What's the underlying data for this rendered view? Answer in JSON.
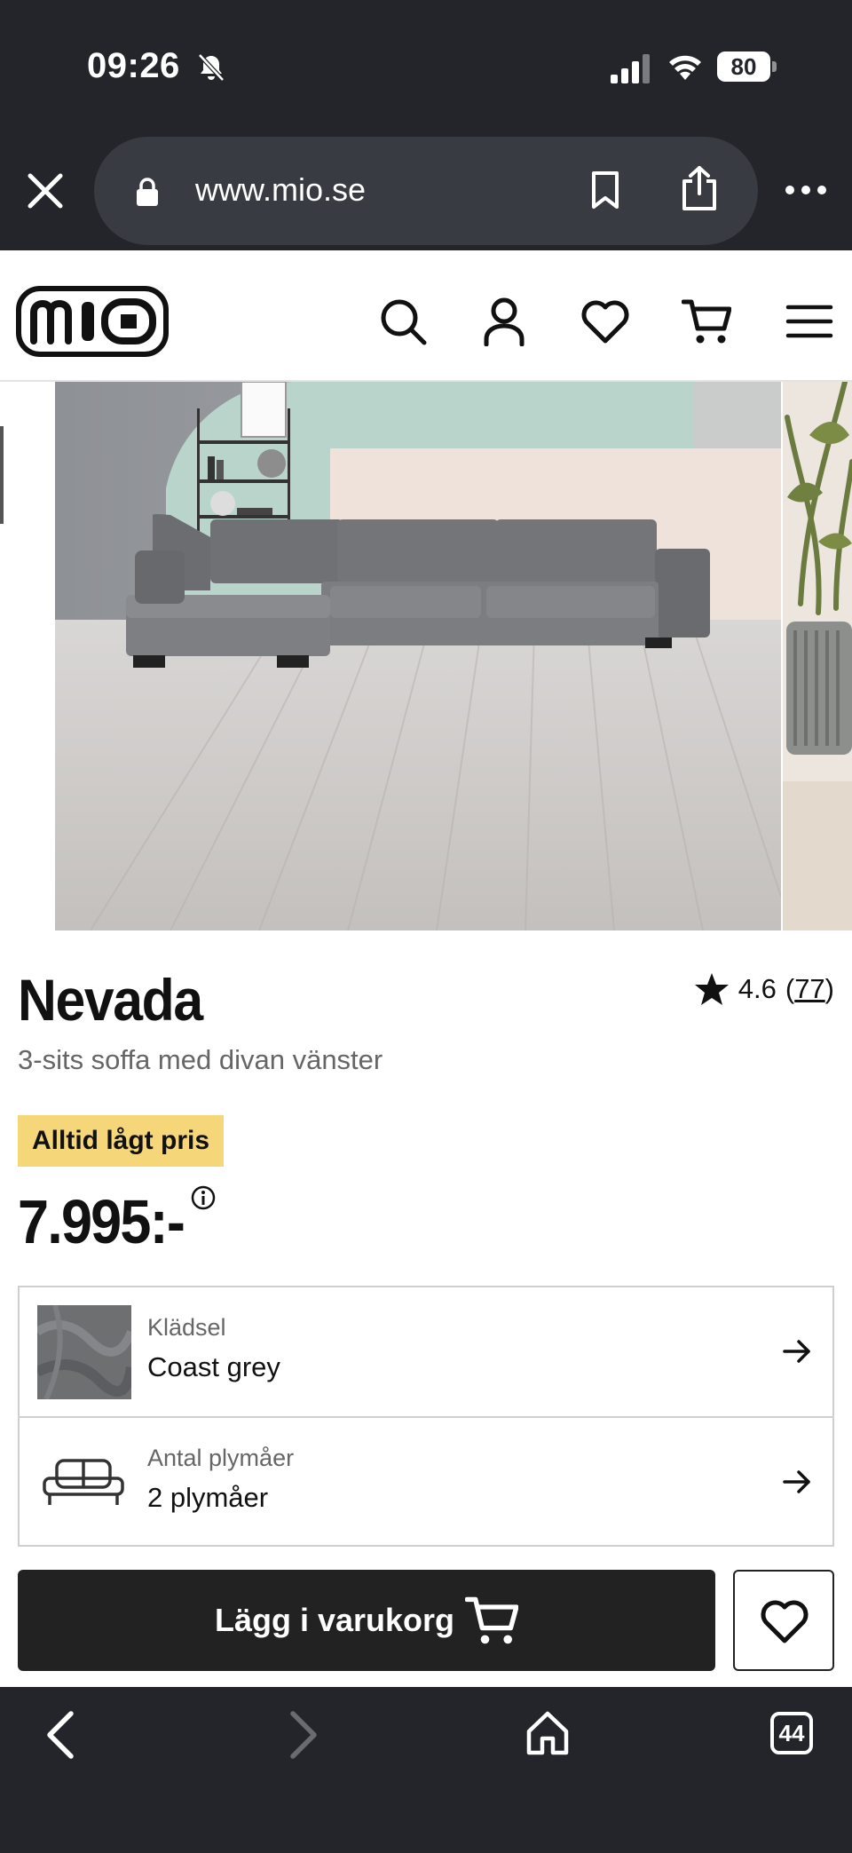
{
  "status_bar": {
    "time": "09:26",
    "battery_level": "80",
    "icons": [
      "bell-off-icon",
      "cellular-signal-icon",
      "wifi-icon",
      "battery-icon"
    ]
  },
  "browser": {
    "url": "www.mio.se",
    "icons": [
      "close-icon",
      "lock-icon",
      "bookmark-icon",
      "share-icon",
      "more-icon"
    ],
    "tabs_count": "44"
  },
  "header": {
    "logo_text": "mio",
    "icons": [
      "search-icon",
      "account-icon",
      "wishlist-heart-icon",
      "cart-icon",
      "menu-icon"
    ]
  },
  "product": {
    "title": "Nevada",
    "subtitle": "3-sits soffa med divan vänster",
    "rating": "4.6",
    "review_count": "77",
    "badge": "Alltid lågt pris",
    "price": "7.995:-"
  },
  "options": [
    {
      "label": "Klädsel",
      "value": "Coast grey"
    },
    {
      "label": "Antal plymåer",
      "value": "2 plymåer"
    }
  ],
  "actions": {
    "add_to_cart": "Lägg i varukorg"
  },
  "colors": {
    "chrome": "#24252a",
    "badge": "#f5d77a",
    "button": "#222222"
  }
}
